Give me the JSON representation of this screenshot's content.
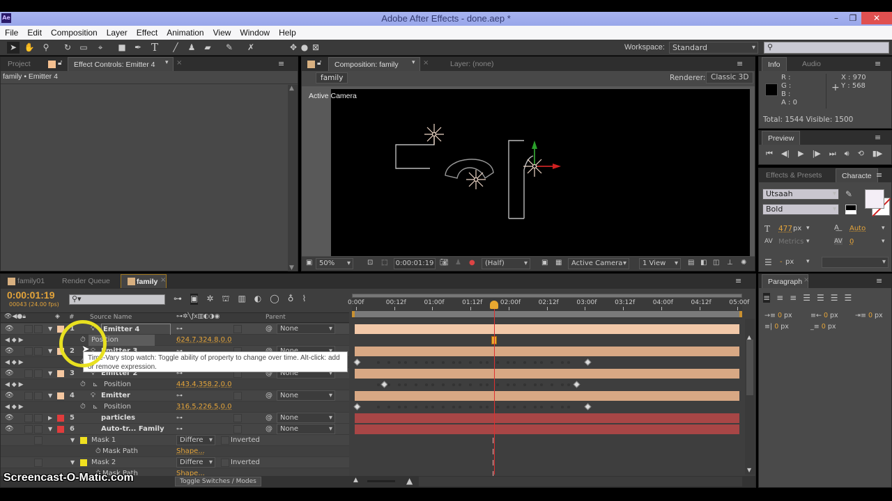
{
  "app": {
    "logo": "Ae",
    "title": "Adobe After Effects - done.aep *",
    "window_controls": {
      "minimize": "–",
      "restore": "❐",
      "close": "✕"
    }
  },
  "menu": [
    "File",
    "Edit",
    "Composition",
    "Layer",
    "Effect",
    "Animation",
    "View",
    "Window",
    "Help"
  ],
  "toolbar": {
    "tools": [
      "selection-tool",
      "hand-tool",
      "zoom-tool",
      "rotate-tool",
      "camera-tool",
      "pan-behind-tool",
      "rectangle-tool",
      "pen-tool",
      "type-tool",
      "brush-tool",
      "clone-stamp-tool",
      "eraser-tool",
      "roto-brush-tool",
      "puppet-pin-tool"
    ],
    "workspace_label": "Workspace:",
    "workspace_value": "Standard",
    "search_placeholder": ""
  },
  "left_panel": {
    "tab_project": "Project",
    "tab_effect_controls": "Effect Controls: Emitter 4",
    "breadcrumb": "family • Emitter 4"
  },
  "comp_panel": {
    "tab_comp": "Composition: family",
    "tab_layer": "Layer: (none)",
    "comp_chip": "family",
    "renderer_label": "Renderer:",
    "renderer_value": "Classic 3D",
    "view_label": "Active Camera",
    "footer": {
      "zoom": "50%",
      "timecode": "0:00:01:19",
      "resolution": "(Half)",
      "camera": "Active Camera",
      "views": "1 View"
    }
  },
  "info_panel": {
    "tab_info": "Info",
    "tab_audio": "Audio",
    "r": "R :",
    "g": "G :",
    "b": "B :",
    "a": "A : 0",
    "x": "X : 970",
    "y": "Y : 568",
    "totals": "Total: 1544   Visible: 1500"
  },
  "preview_panel": {
    "tab": "Preview"
  },
  "character_panel": {
    "tab_effects": "Effects & Presets",
    "tab_character": "Characte",
    "font": "Utsaah",
    "style": "Bold",
    "size_value": "477",
    "size_unit": "px",
    "leading": "Auto",
    "kerning": "Metrics",
    "tracking": "0",
    "stroke_value": "-",
    "stroke_unit": "px",
    "fill_color": "#f4eef6"
  },
  "paragraph_panel": {
    "tab": "Paragraph",
    "indents": [
      {
        "value": "0",
        "unit": "px"
      },
      {
        "value": "0",
        "unit": "px"
      },
      {
        "value": "0",
        "unit": "px"
      },
      {
        "value": "0",
        "unit": "px"
      },
      {
        "value": "0",
        "unit": "px"
      }
    ]
  },
  "timeline": {
    "tabs": [
      {
        "label": "family01",
        "active": false
      },
      {
        "label": "Render Queue",
        "active": false
      },
      {
        "label": "family",
        "active": true
      }
    ],
    "timecode": "0:00:01:19",
    "frame_info": "00043 (24.00 fps)",
    "search_placeholder": "",
    "header": {
      "source_name": "Source Name",
      "parent": "Parent",
      "num": "#"
    },
    "ruler": [
      "0:00f",
      "00:12f",
      "01:00f",
      "01:12f",
      "02:00f",
      "02:12f",
      "03:00f",
      "03:12f",
      "04:00f",
      "04:12f",
      "05:00f"
    ],
    "playhead_fraction": 0.36,
    "layers": [
      {
        "num": "1",
        "name": "Emitter 4",
        "label_color": "#f5c7a0",
        "parent": "None",
        "selected": true
      },
      {
        "prop": "Position",
        "value": "624.7,324.8,0.0"
      },
      {
        "num": "2",
        "name": "Emitter 3",
        "label_color": "#f5c7a0",
        "parent": "None"
      },
      {
        "prop": "Position",
        "value": ""
      },
      {
        "num": "3",
        "name": "Emitter 2",
        "label_color": "#f5c7a0",
        "parent": "None"
      },
      {
        "prop": "Position",
        "value": "443.4,358.2,0.0"
      },
      {
        "num": "4",
        "name": "Emitter",
        "label_color": "#f5c7a0",
        "parent": "None"
      },
      {
        "prop": "Position",
        "value": "316.5,226.5,0.0"
      },
      {
        "num": "5",
        "name": "particles",
        "label_color": "#e03c3c",
        "parent": "None"
      },
      {
        "num": "6",
        "name": "Auto-tr... Family",
        "label_color": "#e03c3c",
        "parent": "None"
      },
      {
        "mask": "Mask 1",
        "mode": "Differe",
        "inverted": "Inverted"
      },
      {
        "prop": "Mask Path",
        "value": "Shape..."
      },
      {
        "mask": "Mask 2",
        "mode": "Differe",
        "inverted": "Inverted"
      },
      {
        "prop": "Mask Path",
        "value": "Shape..."
      }
    ],
    "tooltip": "Time-Vary stop watch: Toggle ability of property to change over time. Alt-click: add or remove expression.",
    "toggle_label": "Toggle Switches / Modes"
  },
  "watermark": "Screencast-O-Matic.com",
  "colors": {
    "accent": "#e4a43a",
    "playhead": "#e03030",
    "layer_bar": "#e0a880",
    "solid_bar": "#a84040"
  }
}
